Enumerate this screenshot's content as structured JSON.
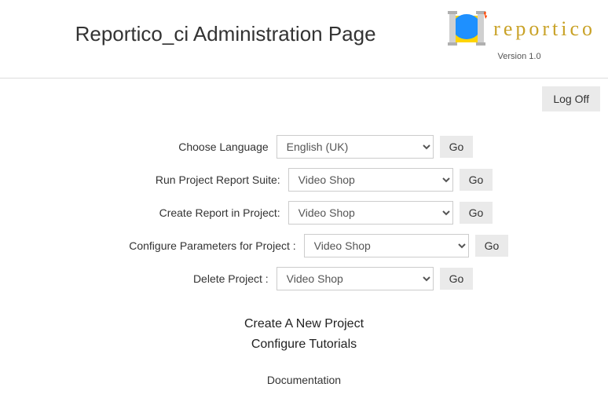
{
  "header": {
    "title": "Reportico_ci Administration Page",
    "logo_text": "reportico",
    "version": "Version 1.0"
  },
  "logoff": {
    "label": "Log Off"
  },
  "rows": {
    "language": {
      "label": "Choose Language",
      "selected": "English (UK)",
      "go": "Go"
    },
    "run_suite": {
      "label": "Run Project Report Suite:",
      "selected": "Video Shop",
      "go": "Go"
    },
    "create_report": {
      "label": "Create Report in Project:",
      "selected": "Video Shop",
      "go": "Go"
    },
    "configure_params": {
      "label": "Configure Parameters for Project :",
      "selected": "Video Shop",
      "go": "Go"
    },
    "delete_project": {
      "label": "Delete Project :",
      "selected": "Video Shop",
      "go": "Go"
    }
  },
  "links": {
    "new_project": "Create A New Project",
    "configure_tutorials": "Configure Tutorials",
    "documentation": "Documentation"
  }
}
